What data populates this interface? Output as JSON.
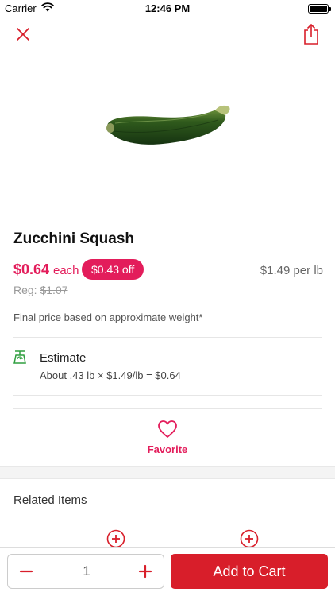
{
  "status_bar": {
    "carrier": "Carrier",
    "time": "12:46 PM"
  },
  "header": {
    "close_icon": "close-icon",
    "share_icon": "share-icon"
  },
  "product": {
    "image_icon": "zucchini-image",
    "name": "Zucchini Squash",
    "price": "$0.64",
    "price_unit": "each",
    "discount": "$0.43 off",
    "price_per_lb": "$1.49 per lb",
    "reg_label": "Reg:",
    "reg_price": "$1.07",
    "disclaimer": "Final price based on approximate weight*"
  },
  "estimate": {
    "icon": "scale-icon",
    "title": "Estimate",
    "detail": "About .43 lb × $1.49/lb = $0.64"
  },
  "favorite": {
    "icon": "heart-icon",
    "label": "Favorite"
  },
  "related": {
    "title": "Related Items"
  },
  "cart": {
    "quantity": "1",
    "add_label": "Add to Cart"
  },
  "colors": {
    "accent": "#e31d5b",
    "cart_button": "#d81e2a",
    "estimate_icon": "#2e9e3e"
  }
}
